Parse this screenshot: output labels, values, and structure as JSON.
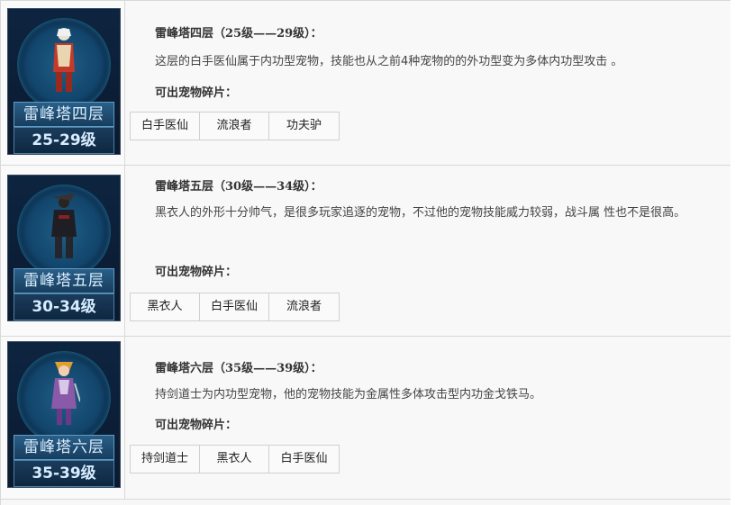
{
  "floors": [
    {
      "card_name": "雷峰塔四层",
      "card_level": "25-29级",
      "title": "雷峰塔四层（25级——29级）：",
      "description": "这层的白手医仙属于内功型宠物，技能也从之前4种宠物的的外功型变为多体内功型攻击 。",
      "drops_label": "可出宠物碎片：",
      "pets": [
        "白手医仙",
        "流浪者",
        "功夫驴"
      ]
    },
    {
      "card_name": "雷峰塔五层",
      "card_level": "30-34级",
      "title": "雷峰塔五层（30级——34级）：",
      "description": "黑衣人的外形十分帅气，是很多玩家追逐的宠物，不过他的宠物技能威力较弱，战斗属 性也不是很高。",
      "drops_label": "可出宠物碎片：",
      "pets": [
        "黑衣人",
        "白手医仙",
        "流浪者"
      ]
    },
    {
      "card_name": "雷峰塔六层",
      "card_level": "35-39级",
      "title": "雷峰塔六层（35级——39级）：",
      "description": "持剑道士为内功型宠物，他的宠物技能为金属性多体攻击型内功金戈铁马。",
      "drops_label": "可出宠物碎片：",
      "pets": [
        "持剑道士",
        "黑衣人",
        "白手医仙"
      ]
    }
  ],
  "colors": {
    "card_bg": "#0d2440",
    "card_frame": "#5e9cc4",
    "row_bg": "#f8f8f8",
    "border": "#d8d8d8"
  }
}
